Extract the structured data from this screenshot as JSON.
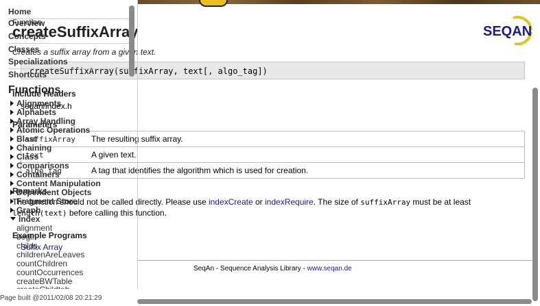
{
  "page": {
    "title": "createSuffixArray",
    "summary": "Creates a suffix array from a given text.",
    "signature": "createSuffixArray(suffixArray, text[, algo_tag])",
    "sections": {
      "include_headers": "Include Headers",
      "include_value": "seqan/index.h",
      "parameters": "Parameters",
      "remarks": "Remarks",
      "example_programs": "Example Programs"
    },
    "parameters": [
      {
        "name": "suffixArray",
        "description": "The resulting suffix array."
      },
      {
        "name": "text",
        "description": "A given text."
      },
      {
        "name": "algo_tag",
        "description": "A tag that identifies the algorithm which is used for creation."
      }
    ],
    "remarks": {
      "prefix": "The function should not be called directly. Please use ",
      "link1": "indexCreate",
      "mid": " or ",
      "link2": "indexRequire",
      "after": ". The size of ",
      "code1": "suffixArray",
      "after2": " must be at least",
      "code2": "length(text)",
      "end": " before calling this function."
    },
    "example_link": "Suffix Array",
    "footer": {
      "text": "SeqAn - Sequence Analysis Library - ",
      "link": "www.seqan.de"
    },
    "page_built": "Page built @2011/02/08 20:21:29",
    "logo_text": "SEQAN"
  },
  "sidebar": {
    "nav": [
      "Home",
      "Overview",
      "Concepts",
      "Classes",
      "Specializations",
      "Shortcuts"
    ],
    "overlap_nav": [
      "Function",
      "Concepts"
    ],
    "functions_heading": "Functions",
    "groups": [
      "Alignments",
      "Alphabets",
      "Array Handling",
      "Atomic Operations",
      "Blast",
      "Chaining",
      "Class",
      "Comparisons",
      "Containers",
      "Content Manipulation",
      "Dependent Objects",
      "Fragment Store",
      "Graph"
    ],
    "open_group": "Index",
    "leaves": [
      "alignment",
      "begin",
      "childs",
      "childrenAreLeaves",
      "countChildren",
      "countOccurrences",
      "createBWTable",
      "createChildtab"
    ]
  },
  "colors": {
    "link": "#1a1a8c",
    "scrollbar": "#8a8a8a",
    "signature_bg": "#e8e8e8",
    "logo_yellow": "#e8c020"
  }
}
